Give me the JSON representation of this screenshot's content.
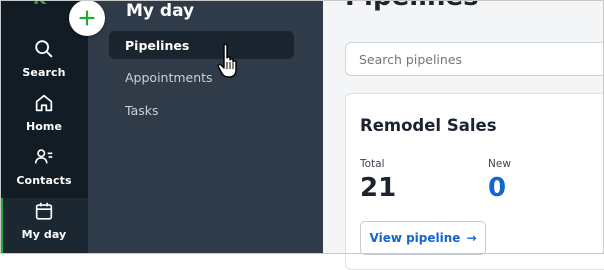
{
  "rail": {
    "items": [
      {
        "label": "Search",
        "icon": "search-icon"
      },
      {
        "label": "Home",
        "icon": "home-icon"
      },
      {
        "label": "Contacts",
        "icon": "contacts-icon"
      },
      {
        "label": "My day",
        "icon": "calendar-icon"
      }
    ],
    "active_label": "My day"
  },
  "add_button": {
    "icon": "plus-icon"
  },
  "subnav": {
    "title": "My day",
    "items": [
      {
        "label": "Pipelines",
        "active": true
      },
      {
        "label": "Appointments"
      },
      {
        "label": "Tasks"
      }
    ]
  },
  "main": {
    "page_title": "Pipelines",
    "search_placeholder": "Search pipelines",
    "card": {
      "title": "Remodel Sales",
      "stats": [
        {
          "label": "Total",
          "value": "21"
        },
        {
          "label": "New",
          "value": "0"
        }
      ],
      "button_label": "View pipeline",
      "button_arrow": "→"
    }
  },
  "colors": {
    "rail_bg": "#111c24",
    "subnav_bg": "#2f3b48",
    "accent_green": "#1faa3a",
    "link_blue": "#1266d1"
  }
}
